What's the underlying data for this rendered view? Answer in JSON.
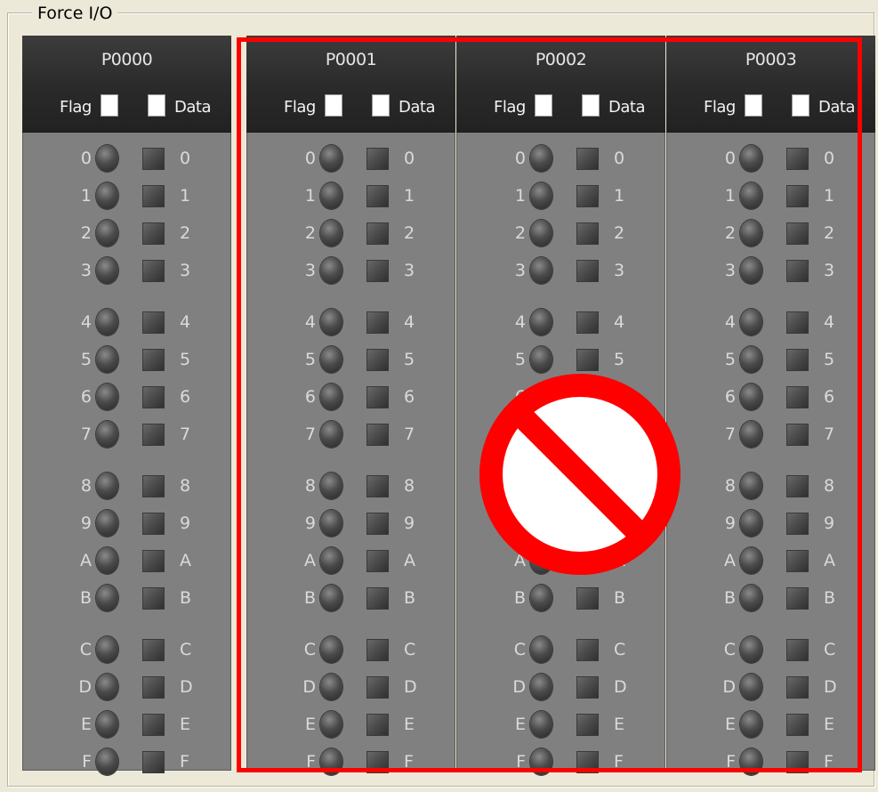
{
  "groupbox": {
    "title": "Force I/O"
  },
  "labels": {
    "flag": "Flag",
    "data": "Data"
  },
  "bits": [
    "0",
    "1",
    "2",
    "3",
    "4",
    "5",
    "6",
    "7",
    "8",
    "9",
    "A",
    "B",
    "C",
    "D",
    "E",
    "F"
  ],
  "columns": [
    {
      "name": "P0000"
    },
    {
      "name": "P0001"
    },
    {
      "name": "P0002"
    },
    {
      "name": "P0003"
    }
  ],
  "highlighted_columns": [
    "P0001",
    "P0002",
    "P0003"
  ],
  "colors": {
    "highlight": "#ff0000",
    "prohibited": "#ff0000"
  },
  "overlay_icon": "prohibited-icon"
}
